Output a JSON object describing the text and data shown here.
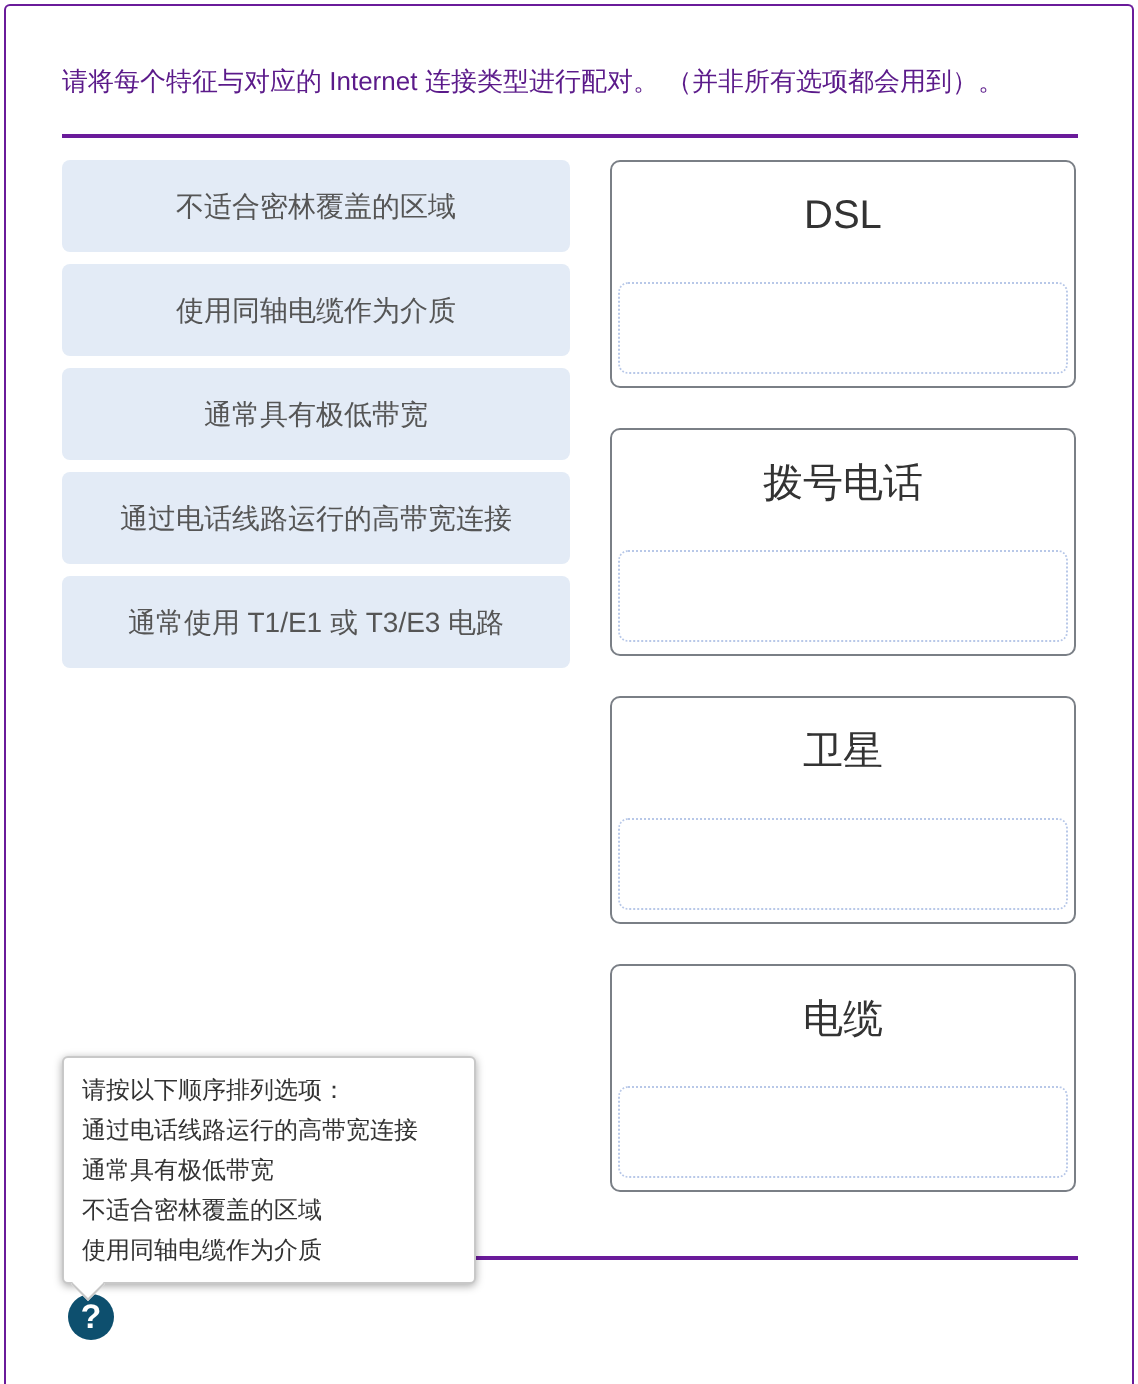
{
  "instruction": "请将每个特征与对应的 Internet 连接类型进行配对。 （并非所有选项都会用到）。",
  "options": [
    {
      "label": "不适合密林覆盖的区域"
    },
    {
      "label": "使用同轴电缆作为介质"
    },
    {
      "label": "通常具有极低带宽"
    },
    {
      "label": "通过电话线路运行的高带宽连接"
    },
    {
      "label": "通常使用 T1/E1 或 T3/E3 电路"
    }
  ],
  "targets": [
    {
      "label": "DSL"
    },
    {
      "label": "拨号电话"
    },
    {
      "label": "卫星"
    },
    {
      "label": "电缆"
    }
  ],
  "hint": {
    "title": "请按以下顺序排列选项：",
    "lines": [
      "通过电话线路运行的高带宽连接",
      "通常具有极低带宽",
      "不适合密林覆盖的区域",
      "使用同轴电缆作为介质"
    ]
  },
  "help": {
    "symbol": "?"
  }
}
